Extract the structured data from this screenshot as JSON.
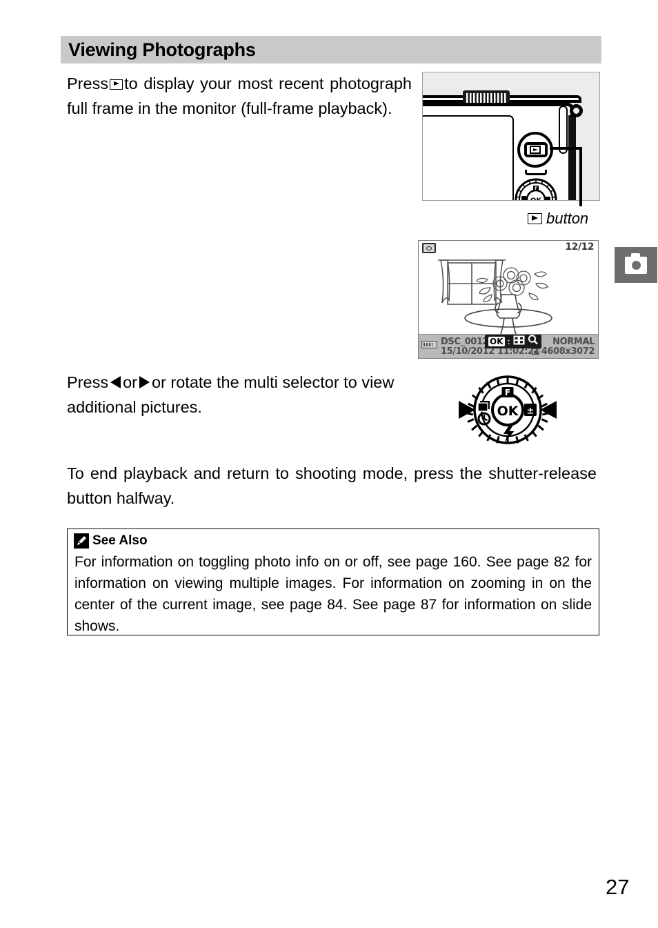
{
  "page": {
    "number": "27",
    "section_title": "Viewing Photographs",
    "margin_tab_icon": "camera-icon"
  },
  "body": {
    "para1_before": "Press",
    "para1_icon": "playback-button-icon",
    "para1_after": "to display your most recent photograph full frame in the monitor (full-frame playback).",
    "para2_before": "Press",
    "para2_icon_left": "triangle-left-icon",
    "para2_middle": "or",
    "para2_icon_right": "triangle-right-icon",
    "para2_after": "or rotate the multi selector to view additional pictures.",
    "para3": "To end playback and return to shooting mode, press the shutter-release button halfway."
  },
  "figures": {
    "camera_caption_icon": "playback-button-icon",
    "camera_caption_text": "button",
    "camera_parts": {
      "playback_button": "playback-button",
      "command_dial": "multi-selector-dial",
      "strap_eyelet": "strap-eyelet",
      "monitor": "camera-monitor",
      "grip_ridges": "grip-ridges"
    },
    "lcd": {
      "mode_icon": "still-image-mode-icon",
      "frame_counter": "12/12",
      "filename": "DSC_0012. JPG",
      "datetime": "15/10/2012 11:02:21",
      "quality": "NORMAL",
      "image_size": "4608x3072",
      "battery_icon": "battery-icon",
      "overlay_ok": "OK",
      "overlay_separator": ":",
      "overlay_thumbnails_icon": "thumbnail-grid-icon",
      "overlay_zoom_icon": "magnifier-icon",
      "artwork": "window-and-flower-vase-illustration"
    },
    "multi_selector": {
      "center_label": "OK",
      "top_label": "F",
      "right_label": "exposure-compensation-icon",
      "left_label_upper": "release-mode-icon",
      "left_label_lower": "self-timer-icon",
      "bottom_label": "flash-icon",
      "arrow_left": "left-arrow",
      "arrow_right": "right-arrow"
    }
  },
  "note": {
    "icon": "pencil-icon",
    "title": "See Also",
    "text": "For information on toggling photo info on or off, see page 160.  See page 82 for information on viewing multiple images.  For information on zooming in on the center of the current image, see page 84.  See page 87 for information on slide shows."
  }
}
